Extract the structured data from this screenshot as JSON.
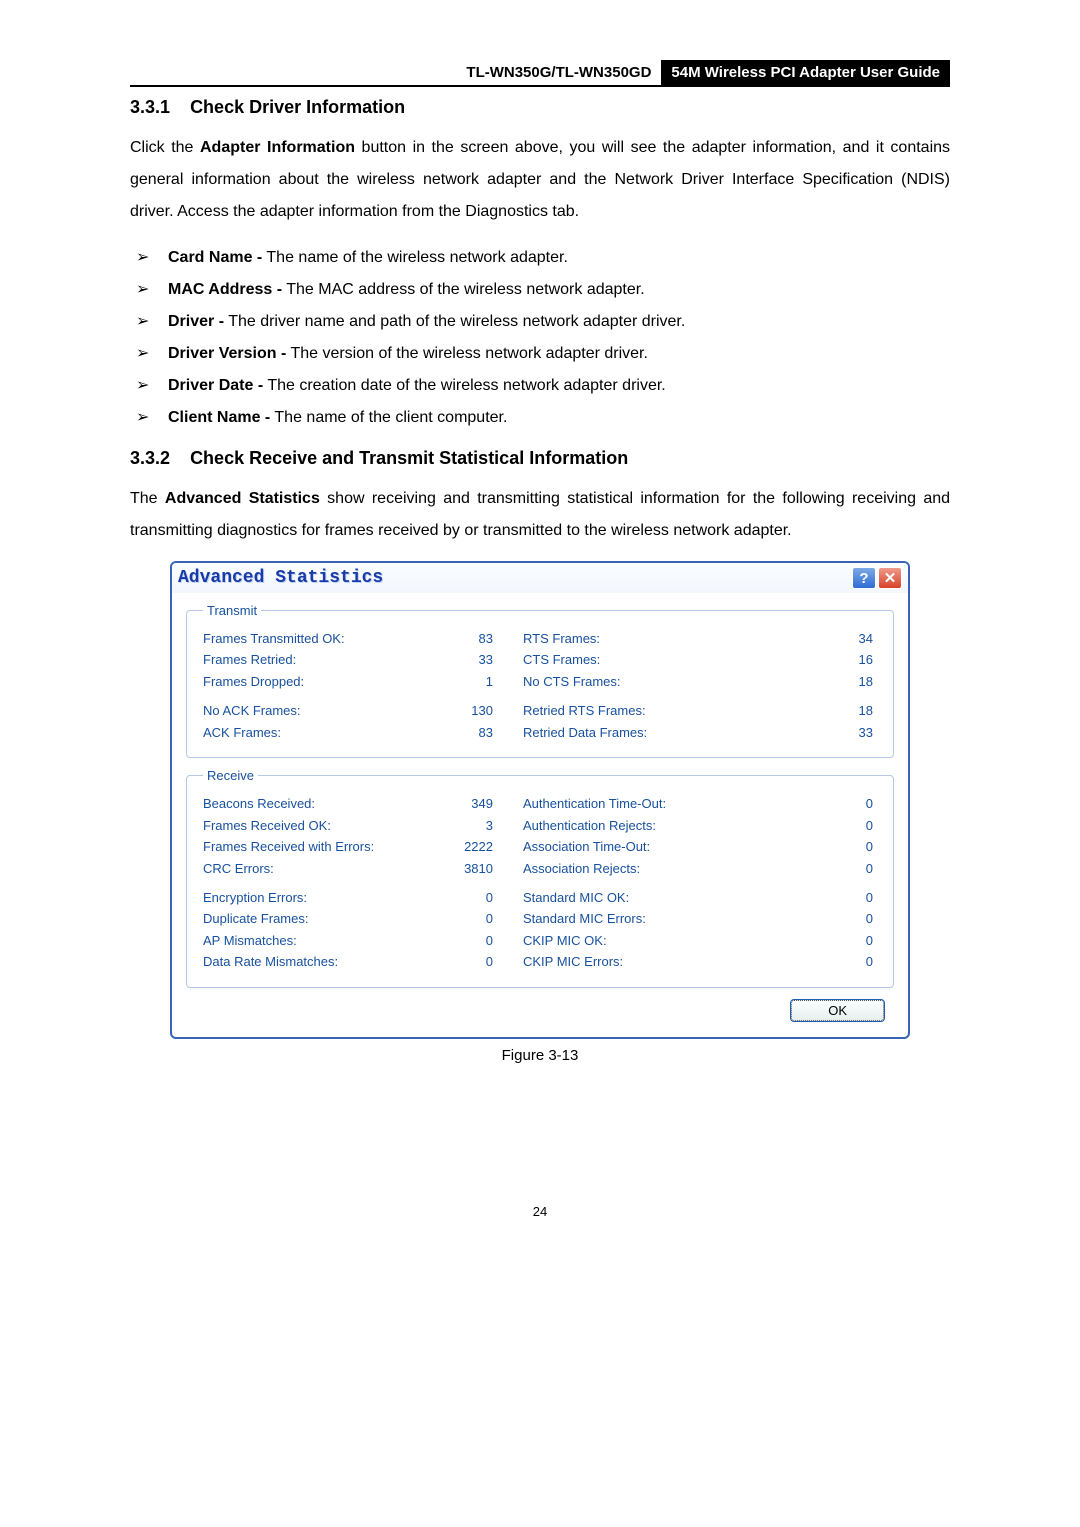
{
  "header": {
    "left": "TL-WN350G/TL-WN350GD",
    "right": "54M  Wireless  PCI  Adapter  User  Guide"
  },
  "section1": {
    "number": "3.3.1",
    "title": "Check Driver Information",
    "para": "Click the Adapter Information button in the screen above, you will see the adapter information, and it contains general information about the wireless network adapter and the Network Driver Interface Specification (NDIS) driver. Access the adapter information from the Diagnostics tab.",
    "para_html_parts": {
      "pre": "Click the ",
      "bold1": "Adapter Information",
      "post": " button in the screen above, you will see the adapter information, and it contains general information about the wireless network adapter and the Network Driver Interface Specification (NDIS) driver. Access the adapter information from the Diagnostics tab."
    },
    "bullets": [
      {
        "bold": "Card Name -",
        "rest": " The name of the wireless network adapter."
      },
      {
        "bold": "MAC Address -",
        "rest": " The MAC address of the wireless network adapter."
      },
      {
        "bold": "Driver -",
        "rest": " The driver name and path of the wireless network adapter driver."
      },
      {
        "bold": "Driver Version -",
        "rest": " The version of the wireless network adapter driver."
      },
      {
        "bold": "Driver Date -",
        "rest": " The creation date of the wireless network adapter driver."
      },
      {
        "bold": "Client Name -",
        "rest": " The name of the client computer."
      }
    ]
  },
  "section2": {
    "number": "3.3.2",
    "title": "Check Receive and Transmit Statistical Information",
    "para_html_parts": {
      "pre": "The ",
      "bold1": "Advanced Statistics",
      "post": " show receiving and transmitting statistical information for the following receiving and transmitting diagnostics for frames received by or transmitted to the wireless network adapter."
    }
  },
  "dialog": {
    "title": "Advanced Statistics",
    "transmit_legend": "Transmit",
    "receive_legend": "Receive",
    "transmit_rows_a": [
      {
        "l1": "Frames Transmitted OK:",
        "v1": "83",
        "l2": "RTS Frames:",
        "v2": "34"
      },
      {
        "l1": "Frames Retried:",
        "v1": "33",
        "l2": "CTS Frames:",
        "v2": "16"
      },
      {
        "l1": "Frames Dropped:",
        "v1": "1",
        "l2": "No CTS Frames:",
        "v2": "18"
      }
    ],
    "transmit_rows_b": [
      {
        "l1": "No ACK Frames:",
        "v1": "130",
        "l2": "Retried RTS Frames:",
        "v2": "18"
      },
      {
        "l1": "ACK Frames:",
        "v1": "83",
        "l2": "Retried Data Frames:",
        "v2": "33"
      }
    ],
    "receive_rows_a": [
      {
        "l1": "Beacons Received:",
        "v1": "349",
        "l2": "Authentication Time-Out:",
        "v2": "0"
      },
      {
        "l1": "Frames Received OK:",
        "v1": "3",
        "l2": "Authentication Rejects:",
        "v2": "0"
      },
      {
        "l1": "Frames Received with Errors:",
        "v1": "2222",
        "l2": "Association Time-Out:",
        "v2": "0"
      },
      {
        "l1": "CRC Errors:",
        "v1": "3810",
        "l2": "Association Rejects:",
        "v2": "0"
      }
    ],
    "receive_rows_b": [
      {
        "l1": "Encryption Errors:",
        "v1": "0",
        "l2": "Standard MIC OK:",
        "v2": "0"
      },
      {
        "l1": "Duplicate Frames:",
        "v1": "0",
        "l2": "Standard MIC Errors:",
        "v2": "0"
      },
      {
        "l1": "AP Mismatches:",
        "v1": "0",
        "l2": "CKIP MIC OK:",
        "v2": "0"
      },
      {
        "l1": "Data Rate Mismatches:",
        "v1": "0",
        "l2": "CKIP MIC Errors:",
        "v2": "0"
      }
    ],
    "ok_label": "OK"
  },
  "caption": "Figure 3-13",
  "page": "24"
}
